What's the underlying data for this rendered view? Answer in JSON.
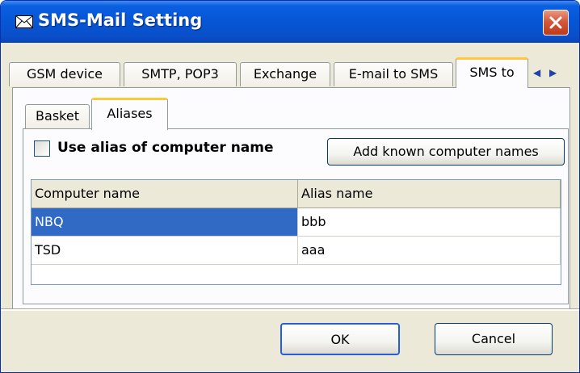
{
  "window": {
    "title": "SMS-Mail Setting",
    "title_icon": "envelope-icon",
    "close_icon": "close-icon"
  },
  "tabs": [
    {
      "label": "GSM device",
      "active": false
    },
    {
      "label": "SMTP, POP3",
      "active": false
    },
    {
      "label": "Exchange",
      "active": false
    },
    {
      "label": "E-mail to SMS",
      "active": false
    },
    {
      "label": "SMS to",
      "active": true
    }
  ],
  "tab_scroll": {
    "left": "◀",
    "right": "▶"
  },
  "subtabs": [
    {
      "label": "Basket",
      "active": false
    },
    {
      "label": "Aliases",
      "active": true
    }
  ],
  "aliases": {
    "use_alias_label": "Use alias of computer name",
    "use_alias_checked": false,
    "add_button_label": "Add known computer names",
    "columns": [
      "Computer name",
      "Alias name"
    ],
    "rows": [
      {
        "computer": "NBQ",
        "alias": "bbb",
        "selected": true
      },
      {
        "computer": "TSD",
        "alias": "aaa",
        "selected": false
      }
    ]
  },
  "footer": {
    "ok_label": "OK",
    "cancel_label": "Cancel"
  },
  "colors": {
    "titlebar": "#0556d6",
    "selection": "#316ac5",
    "active_tab_accent": "#ffc83c"
  }
}
